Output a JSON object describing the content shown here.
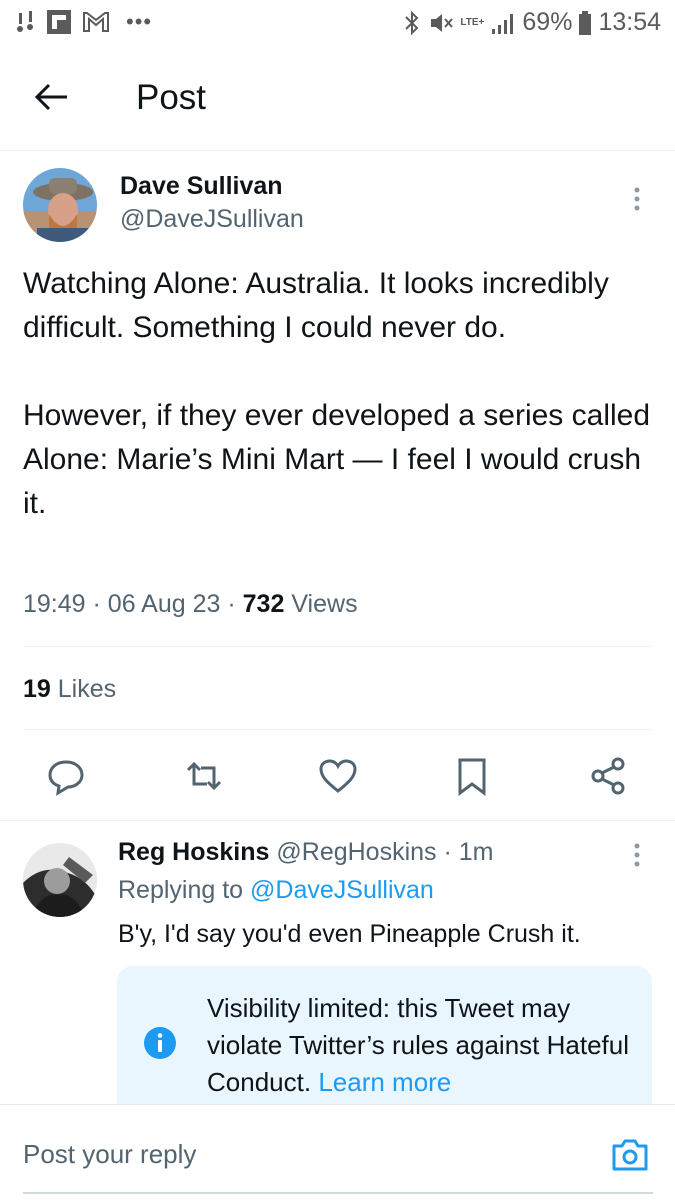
{
  "status_bar": {
    "battery": "69%",
    "time": "13:54",
    "network": "LTE+",
    "icons": [
      "voicemail-icon",
      "flipboard-icon",
      "gmail-icon",
      "more-notifications-icon",
      "bluetooth-icon",
      "mute-icon",
      "signal-icon",
      "battery-icon"
    ]
  },
  "header": {
    "title": "Post",
    "back_icon": "arrow-left-icon"
  },
  "tweet": {
    "author_name": "Dave Sullivan",
    "author_handle": "@DaveJSullivan",
    "text_p1": "Watching Alone: Australia. It looks incredibly difficult. Something I could never do.",
    "text_p2": "However, if they ever developed a series called Alone: Marie’s Mini Mart — I feel I would crush it.",
    "time": "19:49",
    "date": "06 Aug 23",
    "views_count": "732",
    "views_label": "Views",
    "likes_count": "19",
    "likes_label": "Likes",
    "actions": [
      "reply-icon",
      "retweet-icon",
      "like-icon",
      "bookmark-icon",
      "share-icon"
    ]
  },
  "reply": {
    "author_name": "Reg Hoskins",
    "author_handle": "@RegHoskins",
    "time": "1m",
    "replying_prefix": "Replying to",
    "replying_to": "@DaveJSullivan",
    "text": "B'y, I'd say you'd even Pineapple Crush it.",
    "notice_text": "Visibility limited: this Tweet may violate Twitter’s rules against Hateful Conduct.",
    "notice_link": "Learn more"
  },
  "reply_bar": {
    "placeholder": "Post your reply",
    "camera_icon": "camera-icon"
  },
  "colors": {
    "accent": "#1d9bf0",
    "secondary_text": "#536471",
    "notice_bg": "#eaf6fd"
  }
}
